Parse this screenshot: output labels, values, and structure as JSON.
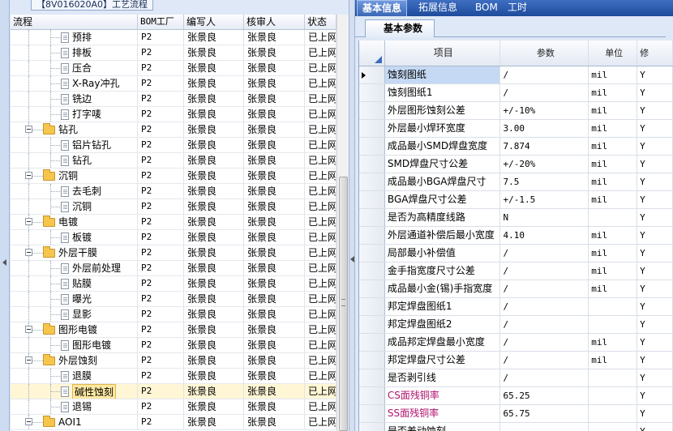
{
  "left": {
    "top_tab_label": "【8V016020A0】工艺流程",
    "columns": [
      "流程",
      "BOM工厂",
      "编写人",
      "核审人",
      "状态"
    ],
    "rows": [
      {
        "label": "预排",
        "level": 2,
        "kind": "doc",
        "bom": "P2",
        "writer": "张景良",
        "checker": "张景良",
        "status": "已上网",
        "selected": false
      },
      {
        "label": "排板",
        "level": 2,
        "kind": "doc",
        "bom": "P2",
        "writer": "张景良",
        "checker": "张景良",
        "status": "已上网",
        "selected": false
      },
      {
        "label": "压合",
        "level": 2,
        "kind": "doc",
        "bom": "P2",
        "writer": "张景良",
        "checker": "张景良",
        "status": "已上网",
        "selected": false
      },
      {
        "label": "X-Ray冲孔",
        "level": 2,
        "kind": "doc",
        "bom": "P2",
        "writer": "张景良",
        "checker": "张景良",
        "status": "已上网",
        "selected": false
      },
      {
        "label": "铣边",
        "level": 2,
        "kind": "doc",
        "bom": "P2",
        "writer": "张景良",
        "checker": "张景良",
        "status": "已上网",
        "selected": false
      },
      {
        "label": "打字唛",
        "level": 2,
        "kind": "doc",
        "bom": "P2",
        "writer": "张景良",
        "checker": "张景良",
        "status": "已上网",
        "selected": false
      },
      {
        "label": "钻孔",
        "level": 1,
        "kind": "folder",
        "bom": "P2",
        "writer": "张景良",
        "checker": "张景良",
        "status": "已上网",
        "selected": false
      },
      {
        "label": "铝片钻孔",
        "level": 2,
        "kind": "doc",
        "bom": "P2",
        "writer": "张景良",
        "checker": "张景良",
        "status": "已上网",
        "selected": false
      },
      {
        "label": "钻孔",
        "level": 2,
        "kind": "doc",
        "bom": "P2",
        "writer": "张景良",
        "checker": "张景良",
        "status": "已上网",
        "selected": false
      },
      {
        "label": "沉铜",
        "level": 1,
        "kind": "folder",
        "bom": "P2",
        "writer": "张景良",
        "checker": "张景良",
        "status": "已上网",
        "selected": false
      },
      {
        "label": "去毛刺",
        "level": 2,
        "kind": "doc",
        "bom": "P2",
        "writer": "张景良",
        "checker": "张景良",
        "status": "已上网",
        "selected": false
      },
      {
        "label": "沉铜",
        "level": 2,
        "kind": "doc",
        "bom": "P2",
        "writer": "张景良",
        "checker": "张景良",
        "status": "已上网",
        "selected": false
      },
      {
        "label": "电镀",
        "level": 1,
        "kind": "folder",
        "bom": "P2",
        "writer": "张景良",
        "checker": "张景良",
        "status": "已上网",
        "selected": false
      },
      {
        "label": "板镀",
        "level": 2,
        "kind": "doc",
        "bom": "P2",
        "writer": "张景良",
        "checker": "张景良",
        "status": "已上网",
        "selected": false
      },
      {
        "label": "外层干膜",
        "level": 1,
        "kind": "folder",
        "bom": "P2",
        "writer": "张景良",
        "checker": "张景良",
        "status": "已上网",
        "selected": false
      },
      {
        "label": "外层前处理",
        "level": 2,
        "kind": "doc",
        "bom": "P2",
        "writer": "张景良",
        "checker": "张景良",
        "status": "已上网",
        "selected": false
      },
      {
        "label": "贴膜",
        "level": 2,
        "kind": "doc",
        "bom": "P2",
        "writer": "张景良",
        "checker": "张景良",
        "status": "已上网",
        "selected": false
      },
      {
        "label": "曝光",
        "level": 2,
        "kind": "doc",
        "bom": "P2",
        "writer": "张景良",
        "checker": "张景良",
        "status": "已上网",
        "selected": false
      },
      {
        "label": "显影",
        "level": 2,
        "kind": "doc",
        "bom": "P2",
        "writer": "张景良",
        "checker": "张景良",
        "status": "已上网",
        "selected": false
      },
      {
        "label": "图形电镀",
        "level": 1,
        "kind": "folder",
        "bom": "P2",
        "writer": "张景良",
        "checker": "张景良",
        "status": "已上网",
        "selected": false
      },
      {
        "label": "图形电镀",
        "level": 2,
        "kind": "doc",
        "bom": "P2",
        "writer": "张景良",
        "checker": "张景良",
        "status": "已上网",
        "selected": false
      },
      {
        "label": "外层蚀刻",
        "level": 1,
        "kind": "folder",
        "bom": "P2",
        "writer": "张景良",
        "checker": "张景良",
        "status": "已上网",
        "selected": false
      },
      {
        "label": "退膜",
        "level": 2,
        "kind": "doc",
        "bom": "P2",
        "writer": "张景良",
        "checker": "张景良",
        "status": "已上网",
        "selected": false
      },
      {
        "label": "碱性蚀刻",
        "level": 2,
        "kind": "doc",
        "bom": "P2",
        "writer": "张景良",
        "checker": "张景良",
        "status": "已上网",
        "selected": true
      },
      {
        "label": "退锡",
        "level": 2,
        "kind": "doc",
        "bom": "P2",
        "writer": "张景良",
        "checker": "张景良",
        "status": "已上网",
        "selected": false
      },
      {
        "label": "AOI1",
        "level": 1,
        "kind": "folder",
        "bom": "P2",
        "writer": "张景良",
        "checker": "张景良",
        "status": "已上网",
        "selected": false
      }
    ]
  },
  "right": {
    "tabs": [
      "基本信息",
      "拓展信息",
      "BOM",
      "工时"
    ],
    "active_tab": 0,
    "subtab_label": "基本参数",
    "columns": [
      "项目",
      "参数",
      "单位",
      "修"
    ],
    "rows": [
      {
        "item": "蚀刻图纸",
        "param": "/",
        "unit": "mil",
        "mod": "Y",
        "current": true,
        "highlight": false
      },
      {
        "item": "蚀刻图纸1",
        "param": "/",
        "unit": "mil",
        "mod": "Y",
        "current": false,
        "highlight": false
      },
      {
        "item": "外层图形蚀刻公差",
        "param": "+/-10%",
        "unit": "mil",
        "mod": "Y",
        "current": false,
        "highlight": false
      },
      {
        "item": "外层最小焊环宽度",
        "param": "3.00",
        "unit": "mil",
        "mod": "Y",
        "current": false,
        "highlight": false
      },
      {
        "item": "成品最小SMD焊盘宽度",
        "param": "7.874",
        "unit": "mil",
        "mod": "Y",
        "current": false,
        "highlight": false
      },
      {
        "item": "SMD焊盘尺寸公差",
        "param": "+/-20%",
        "unit": "mil",
        "mod": "Y",
        "current": false,
        "highlight": false
      },
      {
        "item": "成品最小BGA焊盘尺寸",
        "param": "7.5",
        "unit": "mil",
        "mod": "Y",
        "current": false,
        "highlight": false
      },
      {
        "item": "BGA焊盘尺寸公差",
        "param": "+/-1.5",
        "unit": "mil",
        "mod": "Y",
        "current": false,
        "highlight": false
      },
      {
        "item": "是否为高精度线路",
        "param": "N",
        "unit": "",
        "mod": "Y",
        "current": false,
        "highlight": false
      },
      {
        "item": "外层通道补偿后最小宽度",
        "param": "4.10",
        "unit": "mil",
        "mod": "Y",
        "current": false,
        "highlight": false
      },
      {
        "item": "局部最小补偿值",
        "param": "/",
        "unit": "mil",
        "mod": "Y",
        "current": false,
        "highlight": false
      },
      {
        "item": "金手指宽度尺寸公差",
        "param": "/",
        "unit": "mil",
        "mod": "Y",
        "current": false,
        "highlight": false
      },
      {
        "item": "成品最小金(锡)手指宽度",
        "param": "/",
        "unit": "mil",
        "mod": "Y",
        "current": false,
        "highlight": false
      },
      {
        "item": "邦定焊盘图纸1",
        "param": "/",
        "unit": "",
        "mod": "Y",
        "current": false,
        "highlight": false
      },
      {
        "item": "邦定焊盘图纸2",
        "param": "/",
        "unit": "",
        "mod": "Y",
        "current": false,
        "highlight": false
      },
      {
        "item": "成品邦定焊盘最小宽度",
        "param": "/",
        "unit": "mil",
        "mod": "Y",
        "current": false,
        "highlight": false
      },
      {
        "item": "邦定焊盘尺寸公差",
        "param": "/",
        "unit": "mil",
        "mod": "Y",
        "current": false,
        "highlight": false
      },
      {
        "item": "是否剥引线",
        "param": "/",
        "unit": "",
        "mod": "Y",
        "current": false,
        "highlight": false
      },
      {
        "item": "CS面残铜率",
        "param": "65.25",
        "unit": "",
        "mod": "Y",
        "current": false,
        "highlight": true
      },
      {
        "item": "SS面残铜率",
        "param": "65.75",
        "unit": "",
        "mod": "Y",
        "current": false,
        "highlight": true
      },
      {
        "item": "是否差动蚀刻",
        "param": "",
        "unit": "",
        "mod": "Y",
        "current": false,
        "highlight": false
      }
    ]
  }
}
